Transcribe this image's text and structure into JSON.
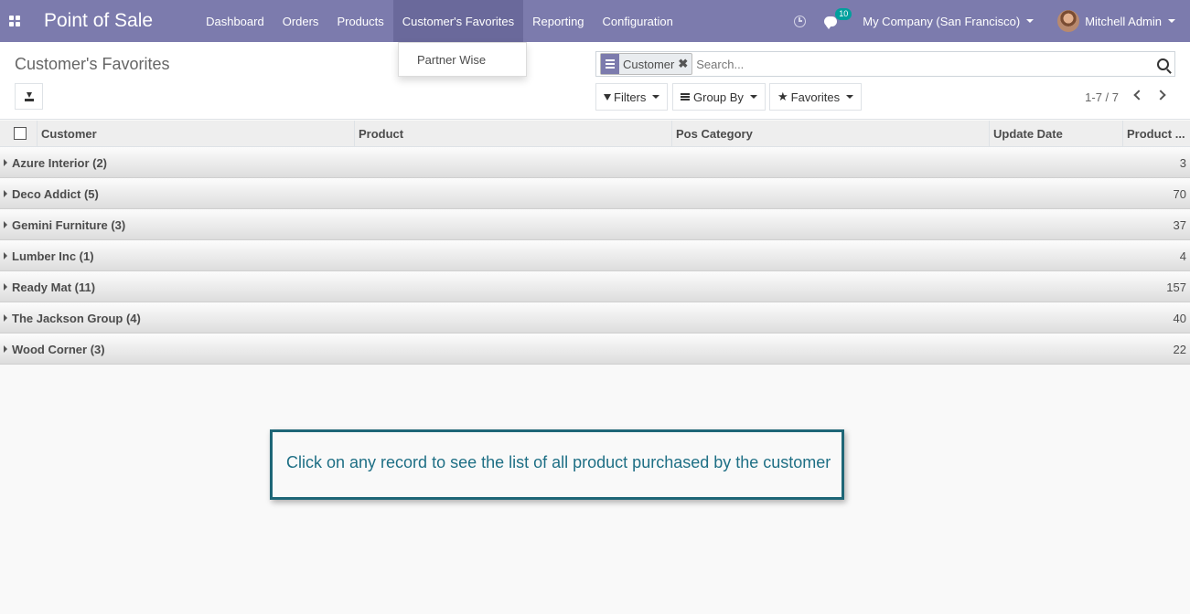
{
  "navbar": {
    "app_title": "Point of Sale",
    "menu": [
      {
        "label": "Dashboard"
      },
      {
        "label": "Orders"
      },
      {
        "label": "Products"
      },
      {
        "label": "Customer's Favorites"
      },
      {
        "label": "Reporting"
      },
      {
        "label": "Configuration"
      }
    ],
    "active_menu": "Customer's Favorites",
    "chat_badge": "10",
    "company": "My Company (San Francisco)",
    "user": "Mitchell Admin",
    "bg_color": "#7c7bad"
  },
  "dropdown": {
    "items": [
      {
        "label": "Partner Wise"
      }
    ]
  },
  "control_panel": {
    "breadcrumb": "Customer's Favorites",
    "search": {
      "facet_label": "Customer",
      "placeholder": "Search..."
    },
    "filters_label": "Filters",
    "groupby_label": "Group By",
    "favorites_label": "Favorites",
    "pager": "1-7 / 7"
  },
  "table": {
    "columns": [
      "Customer",
      "Product",
      "Pos Category",
      "Update Date",
      "Product ..."
    ],
    "groups": [
      {
        "label": "Azure Interior (2)",
        "total": "3"
      },
      {
        "label": "Deco Addict (5)",
        "total": "70"
      },
      {
        "label": "Gemini Furniture (3)",
        "total": "37"
      },
      {
        "label": "Lumber Inc (1)",
        "total": "4"
      },
      {
        "label": "Ready Mat (11)",
        "total": "157"
      },
      {
        "label": "The Jackson Group (4)",
        "total": "40"
      },
      {
        "label": "Wood Corner (3)",
        "total": "22"
      }
    ]
  },
  "annotation": {
    "text": "Click on any record to see the list of all product purchased by the customer"
  }
}
